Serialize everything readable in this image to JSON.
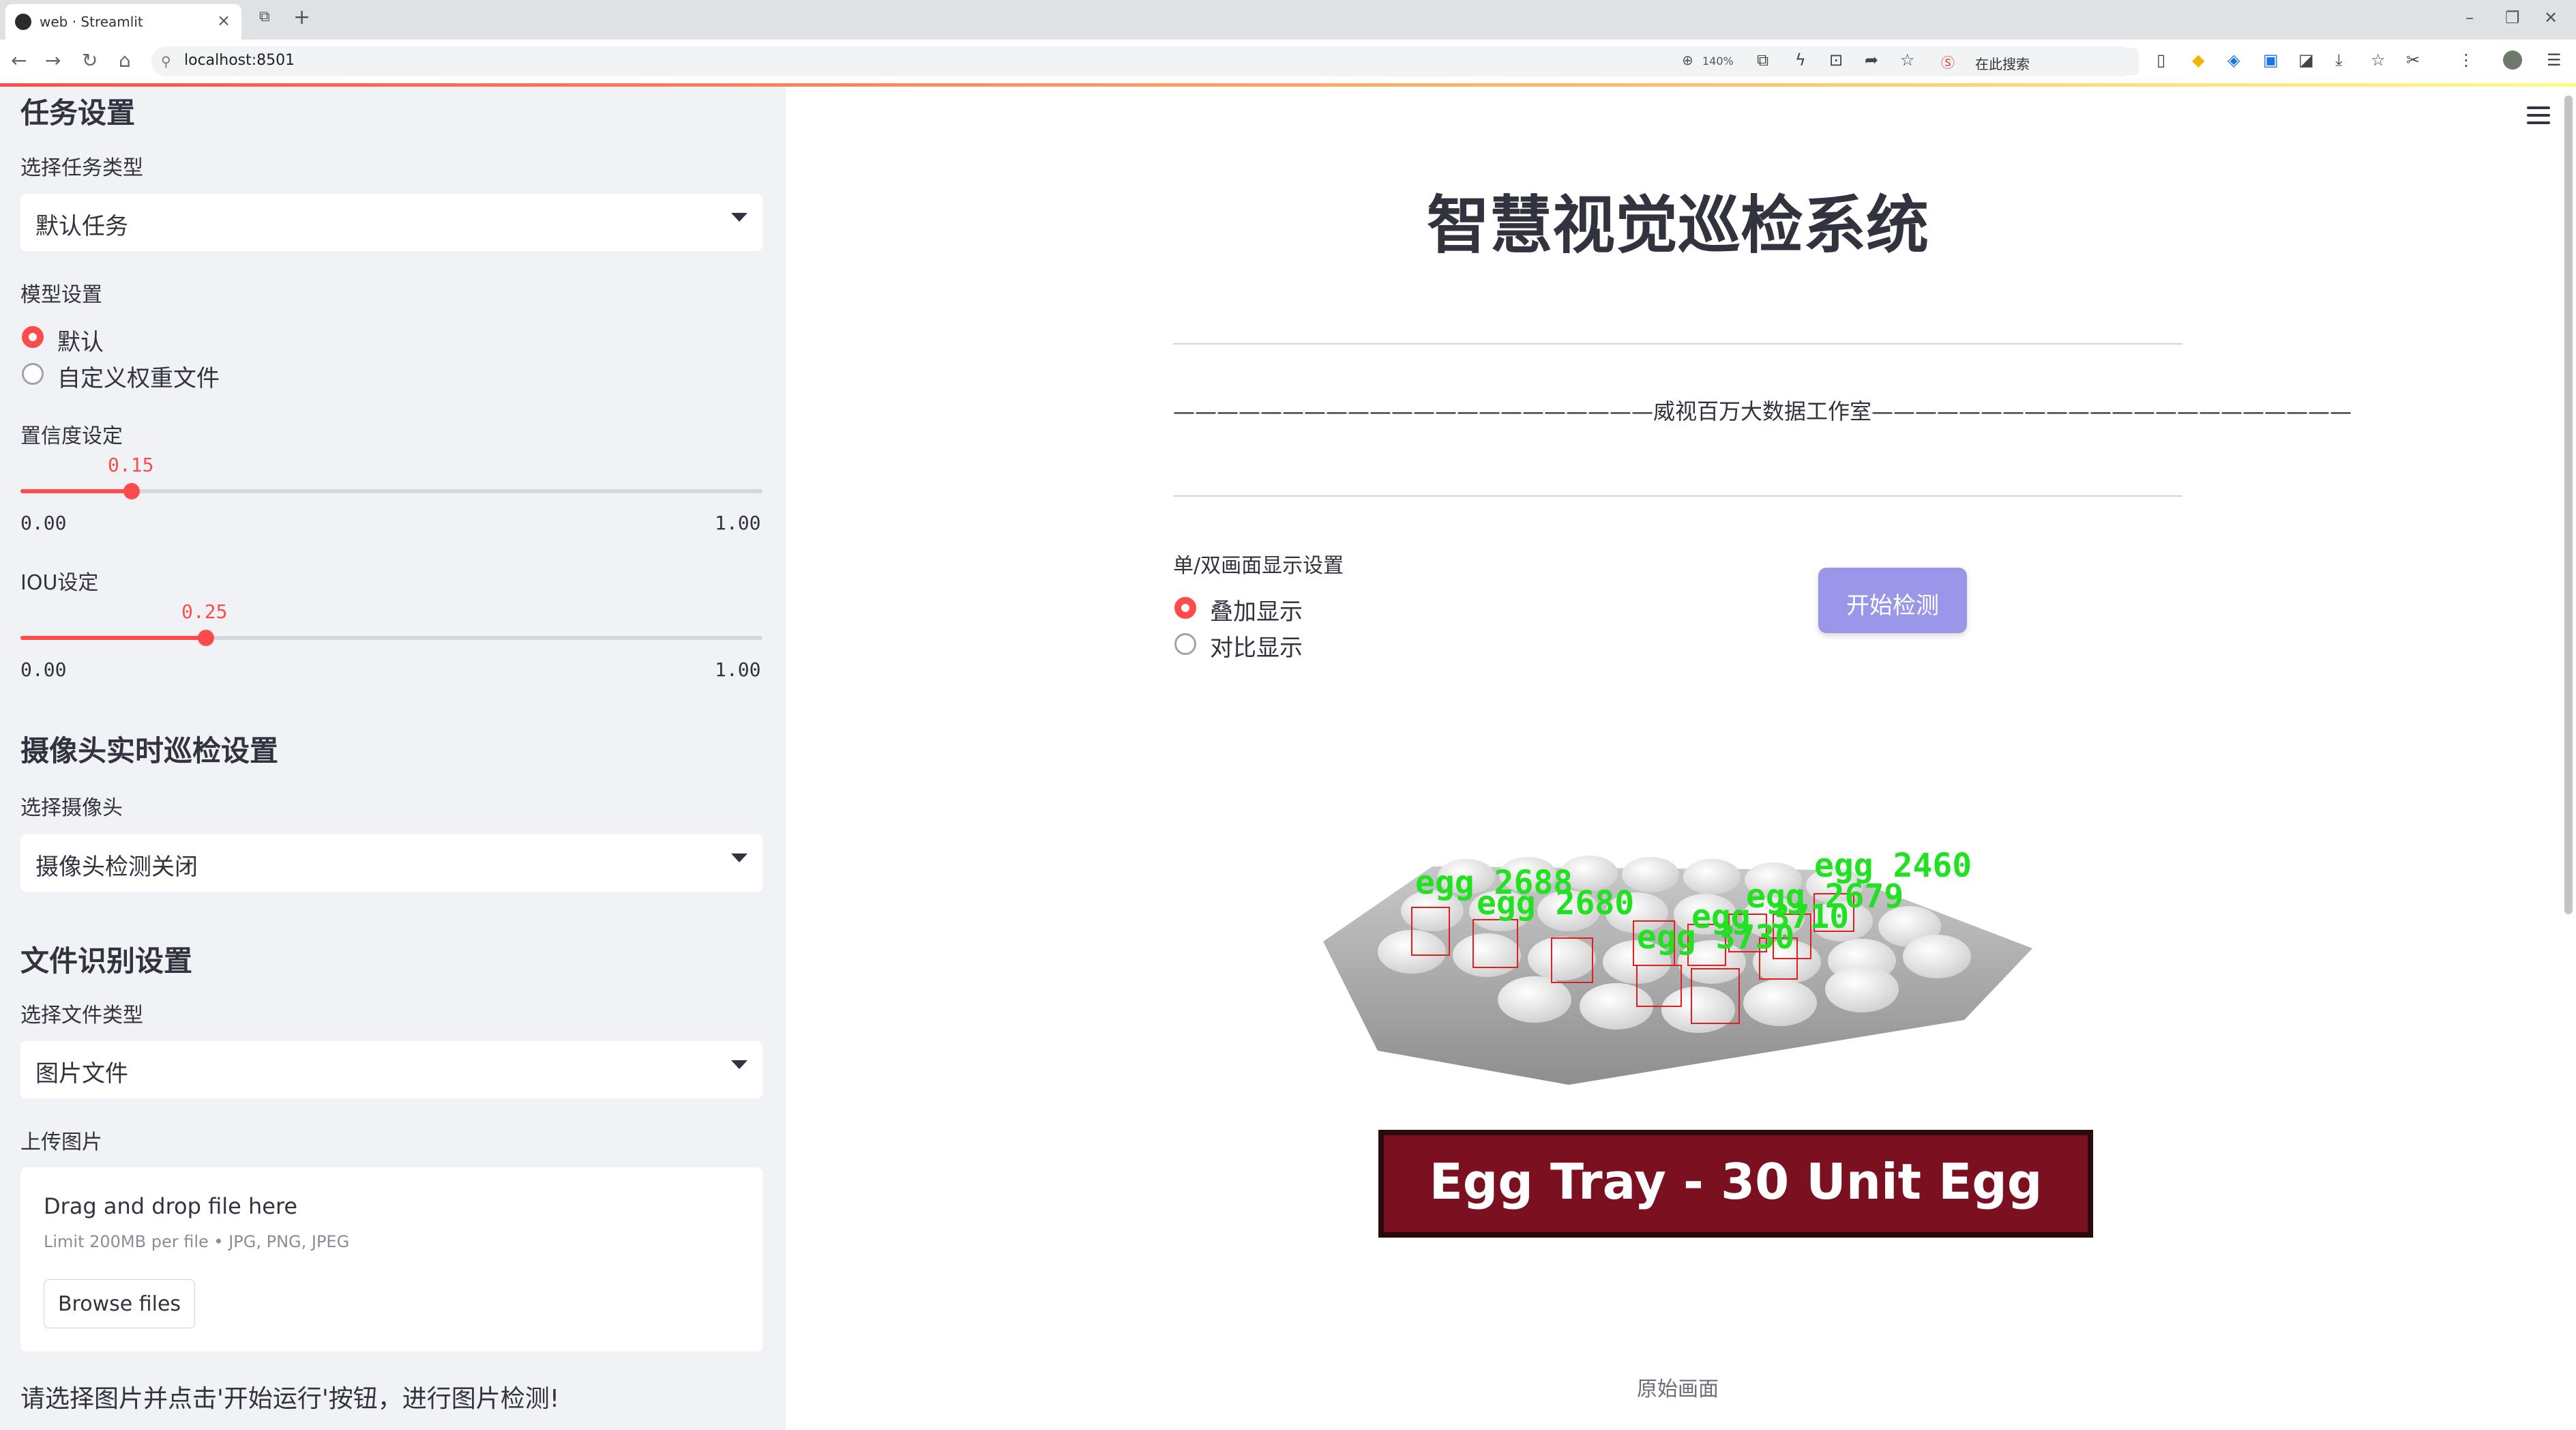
{
  "browser": {
    "tab_title": "web · Streamlit",
    "url": "localhost:8501",
    "zoom": "140%",
    "search_placeholder": "在此搜索"
  },
  "sidebar": {
    "task_heading": "任务设置",
    "task_type_label": "选择任务类型",
    "task_type_value": "默认任务",
    "model_label": "模型设置",
    "model_options": [
      "默认",
      "自定义权重文件"
    ],
    "model_selected": "默认",
    "conf_label": "置信度设定",
    "conf_value": "0.15",
    "conf_min": "0.00",
    "conf_max": "1.00",
    "iou_label": "IOU设定",
    "iou_value": "0.25",
    "iou_min": "0.00",
    "iou_max": "1.00",
    "camera_heading": "摄像头实时巡检设置",
    "camera_label": "选择摄像头",
    "camera_value": "摄像头检测关闭",
    "file_heading": "文件识别设置",
    "file_type_label": "选择文件类型",
    "file_type_value": "图片文件",
    "upload_label": "上传图片",
    "upload_title": "Drag and drop file here",
    "upload_limit": "Limit 200MB per file • JPG, PNG, JPEG",
    "browse_label": "Browse files",
    "hint": "请选择图片并点击'开始运行'按钮，进行图片检测!"
  },
  "main": {
    "title": "智慧视觉巡检系统",
    "studio": "——————————————————————威视百万大数据工作室——————————————————————",
    "display_label": "单/双画面显示设置",
    "display_options": [
      "叠加显示",
      "对比显示"
    ],
    "display_selected": "叠加显示",
    "start_button": "开始检测",
    "caption": "原始画面",
    "image": {
      "banner_text": "Egg Tray - 30 Unit Egg",
      "detections": [
        "egg 2688",
        "egg 2460",
        "egg 2679",
        "egg 3710",
        "egg 3730",
        "egg 2680"
      ]
    }
  },
  "colors": {
    "accent": "#ff4b4b",
    "sidebar_bg": "#f0f2f6",
    "button_bg": "#9a97e8",
    "text": "#31333f",
    "detection_label": "#22e022",
    "detection_box": "#e02020",
    "banner_bg": "#7a1020"
  }
}
